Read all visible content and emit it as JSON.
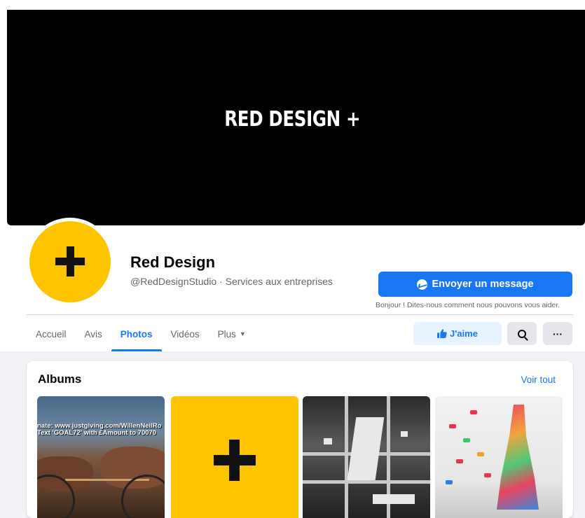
{
  "cover": {
    "text": "RED DESIGN +",
    "background": "#000000"
  },
  "page": {
    "name": "Red Design",
    "subtitle": "@RedDesignStudio · Services aux entreprises",
    "avatar_color": "#ffc400"
  },
  "actions": {
    "message_label": "Envoyer un message",
    "message_icon": "messenger-icon",
    "message_hint": "Bonjour ! Dites-nous comment nous pouvons vous aider.",
    "like_label": "J'aime",
    "like_icon": "thumbs-up-icon",
    "search_icon": "search-icon",
    "more_label": "···"
  },
  "tabs": [
    {
      "label": "Accueil",
      "active": false
    },
    {
      "label": "Avis",
      "active": false
    },
    {
      "label": "Photos",
      "active": true
    },
    {
      "label": "Vidéos",
      "active": false
    },
    {
      "label": "Plus",
      "active": false,
      "dropdown": true
    }
  ],
  "albums": {
    "title": "Albums",
    "see_all": "Voir tout",
    "items": [
      {
        "caption_line1": "nate: www.justgiving.com/WillenNeilRo",
        "caption_line2": "Text 'GOAL72' with £Amount to 70070"
      },
      {
        "caption_line1": "",
        "caption_line2": ""
      },
      {
        "caption_line1": "",
        "caption_line2": ""
      },
      {
        "caption_line1": "",
        "caption_line2": ""
      }
    ]
  },
  "colors": {
    "accent": "#1877f2",
    "accent_light": "#e7f3ff",
    "muted": "#65676b"
  }
}
